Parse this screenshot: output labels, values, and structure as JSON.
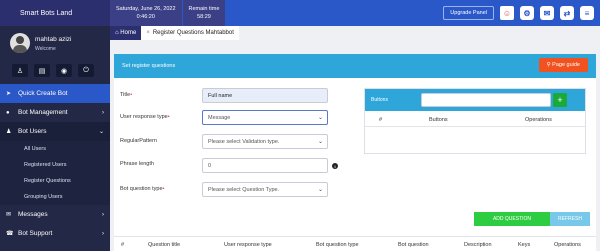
{
  "app": {
    "brand": "Smart Bots Land"
  },
  "topbar": {
    "date": "Saturday, June 26, 2022",
    "time": "0:46:20",
    "remain_label": "Remain time",
    "remain_value": "58:29",
    "upgrade_label": "Upgrade Panel",
    "icons": [
      "avatar-icon",
      "gear-icon",
      "chat-icon",
      "toggle-icon",
      "menu-icon"
    ]
  },
  "profile": {
    "name": "mahtab azizi",
    "welcome": "Welcome",
    "icons": [
      "user-icon",
      "document-icon",
      "settings-icon",
      "power-icon"
    ]
  },
  "sidebar": {
    "items": [
      {
        "label": "Quick Create Bot"
      },
      {
        "label": "Bot Management"
      },
      {
        "label": "Bot Users"
      },
      {
        "label": "Messages"
      },
      {
        "label": "Bot Support"
      }
    ],
    "subitems": [
      {
        "label": "All Users"
      },
      {
        "label": "Registered Users"
      },
      {
        "label": "Register Questions"
      },
      {
        "label": "Grouping Users"
      }
    ]
  },
  "tabs": {
    "home": "Home",
    "current": "Register Questions Mahtabbot"
  },
  "panel": {
    "header": "Set register questions",
    "page_guide": "Page guide"
  },
  "form": {
    "title_label": "Title",
    "title_value": "Full name",
    "response_label": "User response type",
    "response_value": "Message",
    "pattern_label": "RegularPattern",
    "pattern_placeholder": "Please select Validation type.",
    "phrase_label": "Phrase length",
    "phrase_value": "0",
    "qtype_label": "Bot question type",
    "qtype_placeholder": "Please select Question Type."
  },
  "buttons_box": {
    "label": "Buttons",
    "cols": {
      "num": "#",
      "buttons": "Buttons",
      "operations": "Operations"
    }
  },
  "actions": {
    "add": "ADD QUESTION",
    "refresh": "REFRESH"
  },
  "table": {
    "columns": [
      "#",
      "Question title",
      "User response type",
      "Bot question type",
      "Bot question",
      "Description",
      "Keys",
      "Operations"
    ]
  },
  "colors": {
    "sidebar_bg": "#232846",
    "topbar_blue": "#2b58c8",
    "header_cyan": "#2fa6da",
    "page_guide_orange": "#f2521f",
    "add_green": "#2ecc40",
    "plus_green": "#1aaa3a",
    "required_red": "#e53935"
  }
}
